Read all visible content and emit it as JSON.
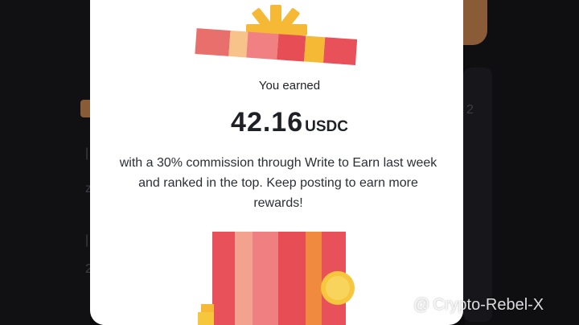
{
  "reward": {
    "earned_label": "You earned",
    "amount": "42.16",
    "currency": "USDC",
    "description": "with a 30% commission through Write to Earn last week and ranked in the top. Keep posting to earn more rewards!"
  },
  "background": {
    "right_mark": "2",
    "left_marks": [
      "|",
      "z",
      "|",
      "2"
    ]
  },
  "watermark": {
    "prefix": "@",
    "handle": "Crypto-Rebel-X",
    "logo_icon": "binance-diamond-icon"
  },
  "colors": {
    "ribbon_gold": "#f5b936",
    "gift_red": "#e64d55",
    "gift_pink": "#f17f7f",
    "gift_orange": "#f08a3e",
    "coin_gold": "#f6c63c",
    "text_dark": "#1e2026"
  }
}
